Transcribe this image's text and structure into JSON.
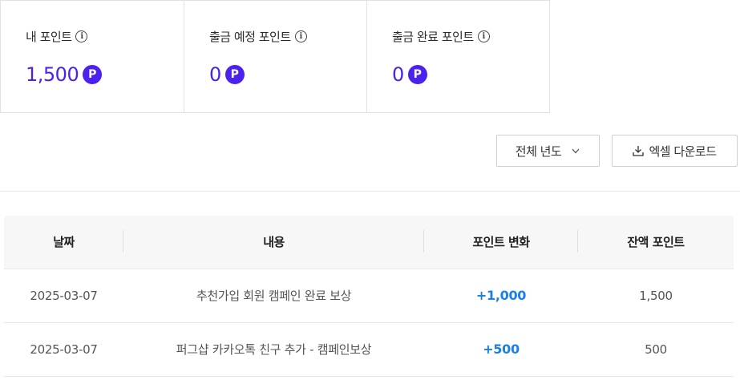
{
  "summary": {
    "cards": [
      {
        "title": "내 포인트",
        "value": "1,500",
        "badge": "P"
      },
      {
        "title": "출금 예정 포인트",
        "value": "0",
        "badge": "P"
      },
      {
        "title": "출금 완료 포인트",
        "value": "0",
        "badge": "P"
      }
    ]
  },
  "filters": {
    "year_label": "전체 년도",
    "excel_label": "엑셀 다운로드"
  },
  "table": {
    "headers": [
      "날짜",
      "내용",
      "포인트 변화",
      "잔액 포인트"
    ],
    "rows": [
      {
        "date": "2025-03-07",
        "content": "추천가입 회원 캠페인 완료 보상",
        "change": "+1,000",
        "balance": "1,500"
      },
      {
        "date": "2025-03-07",
        "content": "퍼그샵 카카오톡 친구 추가 - 캠페인보상",
        "change": "+500",
        "balance": "500"
      }
    ]
  },
  "colors": {
    "accent": "#4b21f0",
    "change_positive": "#1a80e6"
  },
  "icons": {
    "info": "info-icon",
    "point": "point-badge-icon",
    "chevron": "chevron-down-icon",
    "download": "download-icon"
  }
}
